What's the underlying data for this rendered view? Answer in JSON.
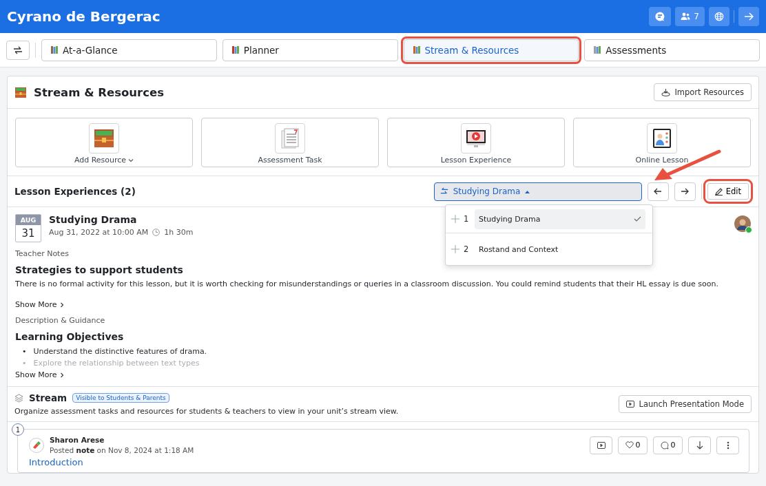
{
  "app_title": "Cyrano de Bergerac",
  "header_buttons": [
    {
      "kind": "chat"
    },
    {
      "kind": "people",
      "label": "7"
    },
    {
      "kind": "globe"
    },
    {
      "kind": "exit"
    }
  ],
  "tabs": [
    {
      "label": "At-a-Glance",
      "selected": false
    },
    {
      "label": "Planner",
      "selected": false
    },
    {
      "label": "Stream & Resources",
      "selected": true
    },
    {
      "label": "Assessments",
      "selected": false
    }
  ],
  "panel": {
    "title": "Stream & Resources",
    "import_button": "Import Resources"
  },
  "actions": [
    {
      "label": "Add Resource",
      "has_menu": true
    },
    {
      "label": "Assessment Task",
      "has_menu": false
    },
    {
      "label": "Lesson Experience",
      "has_menu": false
    },
    {
      "label": "Online Lesson",
      "has_menu": false
    }
  ],
  "lessons": {
    "title": "Lesson Experiences (2)",
    "current": "Studying Drama",
    "edit_button": "Edit",
    "menu": [
      {
        "number": "1",
        "label": "Studying Drama",
        "selected": true
      },
      {
        "number": "2",
        "label": "Rostand and Context",
        "selected": false
      }
    ]
  },
  "lesson": {
    "month": "AUG",
    "day": "31",
    "title": "Studying Drama",
    "when": "Aug 31, 2022 at 10:00 AM",
    "duration": "1h 30m",
    "online": true,
    "teacher_notes_label": "Teacher Notes",
    "notes_heading": "Strategies to support students",
    "notes_text": "There is no formal activity for this lesson, but it is worth checking for misunderstandings or queries in a classroom discussion. You could remind students that their HL essay is due soon.",
    "show_more": "Show More",
    "description_label": "Description & Guidance",
    "objectives_heading": "Learning Objectives",
    "objectives": [
      {
        "marker": "•",
        "text": "Understand the distinctive features of drama.",
        "faded": false
      },
      {
        "marker": "•",
        "text": "Explore the relationship between text types",
        "faded": true
      }
    ],
    "show_more_2": "Show More"
  },
  "stream": {
    "title": "Stream",
    "badge": "Visible to Students & Parents",
    "description": "Organize assessment tasks and resources for students & teachers to view in your unit’s stream view.",
    "launch_button": "Launch Presentation Mode"
  },
  "post": {
    "number": "1",
    "author": "Sharon Arese",
    "posted_prefix": "Posted",
    "post_type": "note",
    "posted_suffix": "on Nov 8, 2024 at 1:18 AM",
    "likes": "0",
    "comments": "0",
    "title": "Introduction"
  }
}
